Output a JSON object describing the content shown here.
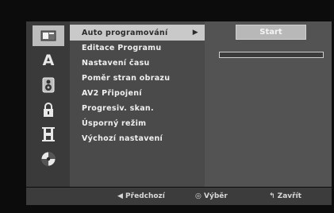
{
  "icons": [
    {
      "name": "disc-setup-icon"
    },
    {
      "name": "language-icon",
      "glyph": "A"
    },
    {
      "name": "audio-icon"
    },
    {
      "name": "lock-icon"
    },
    {
      "name": "recording-icon"
    },
    {
      "name": "disc-icon"
    }
  ],
  "menu": {
    "items": [
      {
        "label": "Auto programování",
        "selected": true
      },
      {
        "label": "Editace Programu"
      },
      {
        "label": "Nastavení času"
      },
      {
        "label": "Poměr stran obrazu"
      },
      {
        "label": "AV2 Připojení"
      },
      {
        "label": "Progresiv. skan."
      },
      {
        "label": "Úsporný režim"
      },
      {
        "label": "Výchozí nastavení"
      }
    ],
    "submenu_arrow": "▶"
  },
  "right": {
    "start_label": "Start",
    "progress_percent": 0
  },
  "footer": {
    "prev_label": "◀ Předchozí",
    "select_label": "◎ Výběr",
    "close_label": "↰ Zavřít"
  }
}
